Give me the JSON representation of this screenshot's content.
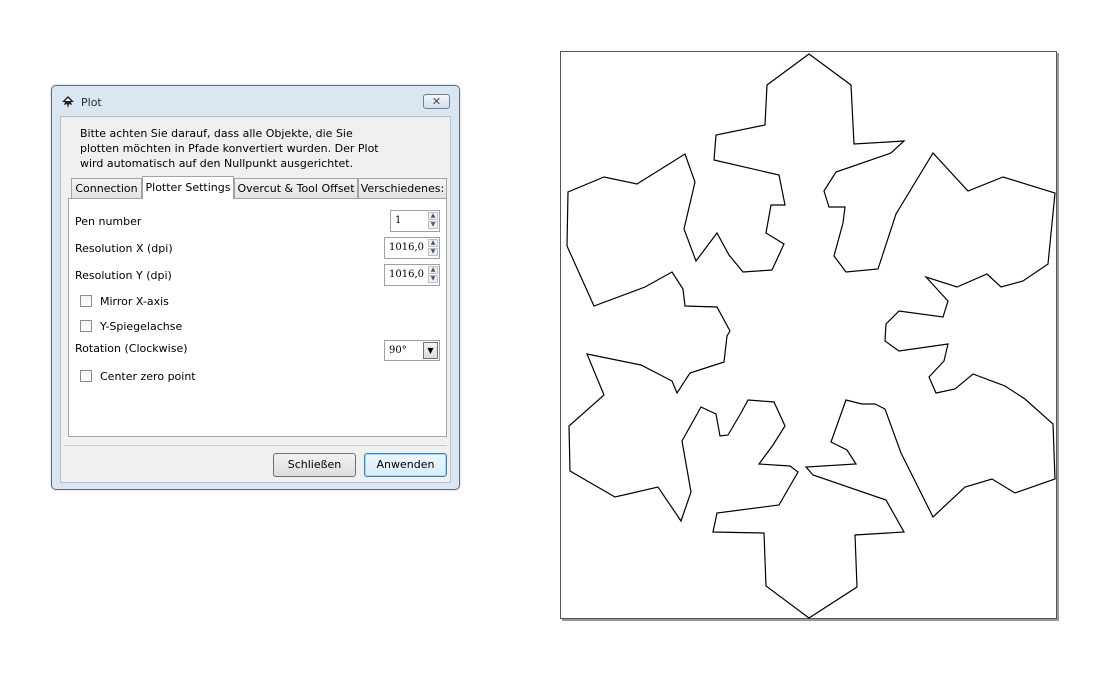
{
  "dialog": {
    "title": "Plot",
    "info_text": "Bitte achten Sie darauf, dass alle Objekte, die Sie\nplotten möchten in Pfade konvertiert wurden. Der Plot\nwird automatisch auf den Nullpunkt ausgerichtet.",
    "tabs": [
      {
        "label": "Connection"
      },
      {
        "label": "Plotter Settings"
      },
      {
        "label": "Overcut & Tool Offset"
      },
      {
        "label": "Verschiedenes:"
      }
    ],
    "active_tab": "Plotter Settings",
    "settings": {
      "pen_number_label": "Pen number",
      "pen_number_value": "1",
      "resolution_x_label": "Resolution X (dpi)",
      "resolution_x_value": "1016,0",
      "resolution_y_label": "Resolution Y (dpi)",
      "resolution_y_value": "1016,0",
      "mirror_x_label": "Mirror X-axis",
      "mirror_x_checked": false,
      "mirror_y_label": "Y-Spiegelachse",
      "mirror_y_checked": false,
      "rotation_label": "Rotation (Clockwise)",
      "rotation_value": "90°",
      "center_zero_label": "Center zero point",
      "center_zero_checked": false
    },
    "buttons": {
      "close_label": "Schließen",
      "apply_label": "Anwenden"
    },
    "close_glyph": "✕"
  },
  "canvas": {
    "shape": "snowflake-outline",
    "stroke_color": "#000000",
    "fill_color": "#ffffff"
  }
}
